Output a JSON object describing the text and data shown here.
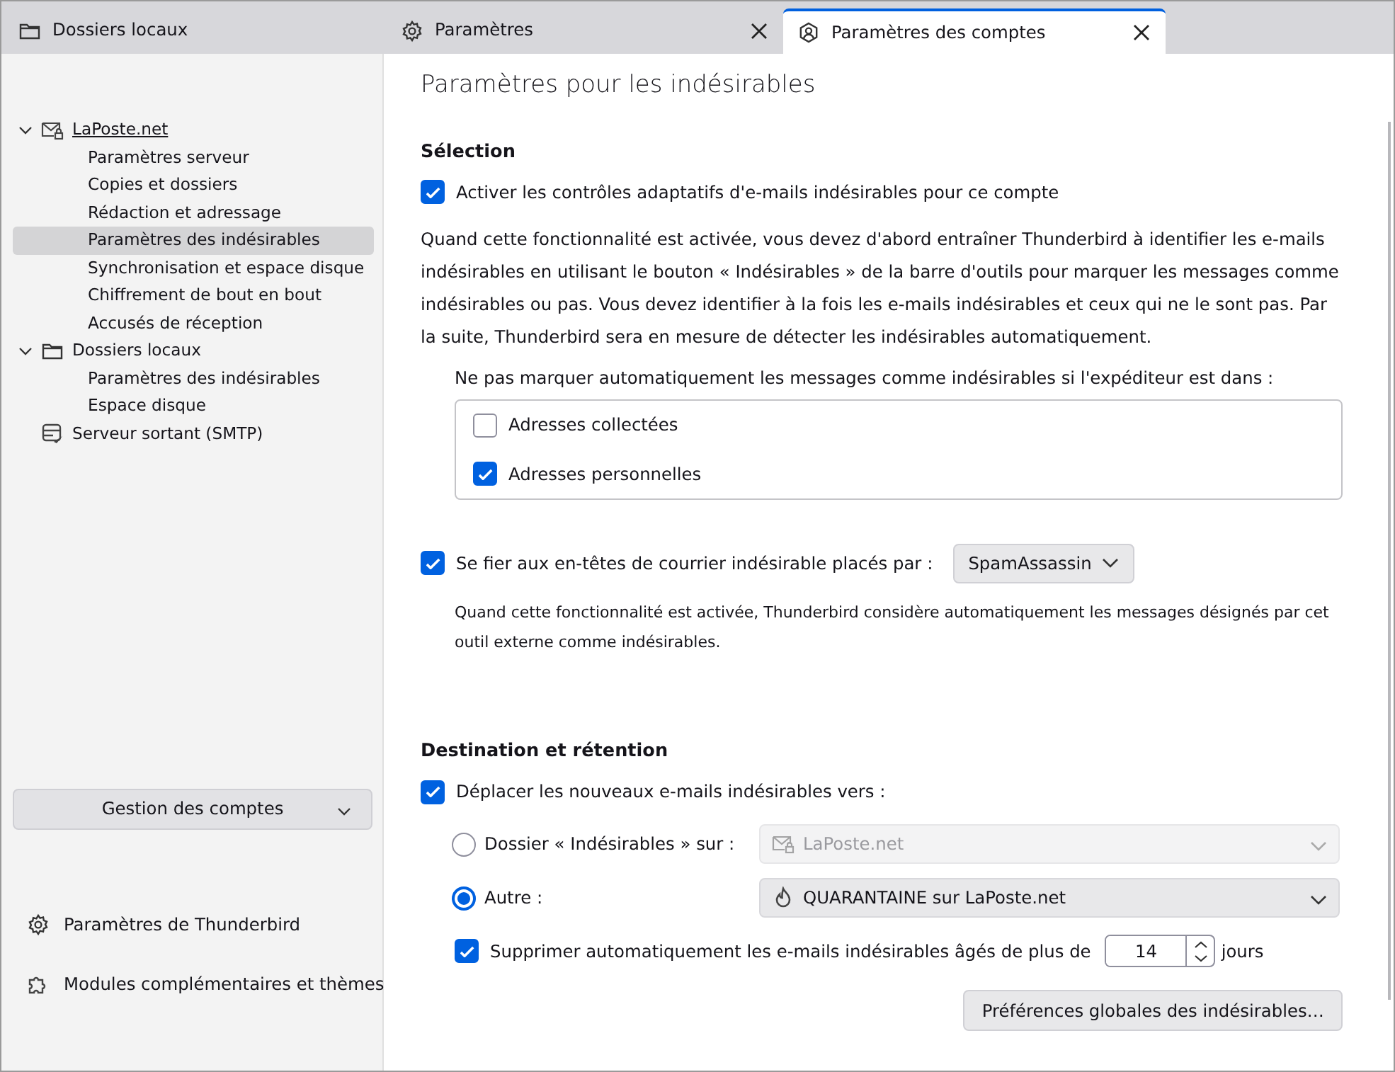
{
  "tabs": [
    {
      "label": "Dossiers locaux",
      "selected": false
    },
    {
      "label": "Paramètres",
      "selected": false
    },
    {
      "label": "Paramètres des comptes",
      "selected": true
    }
  ],
  "sidebar": {
    "tree": [
      {
        "label": "LaPoste.net",
        "expanded": true,
        "selected": false,
        "children": [
          {
            "label": "Paramètres serveur",
            "selected": false
          },
          {
            "label": "Copies et dossiers",
            "selected": false
          },
          {
            "label": "Rédaction et adressage",
            "selected": false
          },
          {
            "label": "Paramètres des indésirables",
            "selected": true
          },
          {
            "label": "Synchronisation et espace disque",
            "selected": false
          },
          {
            "label": "Chiffrement de bout en bout",
            "selected": false
          },
          {
            "label": "Accusés de réception",
            "selected": false
          }
        ]
      },
      {
        "label": "Dossiers locaux",
        "expanded": true,
        "selected": false,
        "children": [
          {
            "label": "Paramètres des indésirables",
            "selected": false
          },
          {
            "label": "Espace disque",
            "selected": false
          }
        ]
      },
      {
        "label": "Serveur sortant (SMTP)",
        "selected": false
      }
    ],
    "account_actions": "Gestion des comptes",
    "footer_links": [
      "Paramètres de Thunderbird",
      "Modules complémentaires et thèmes"
    ]
  },
  "page": {
    "title": "Paramètres pour les indésirables",
    "selection": {
      "heading": "Sélection",
      "adaptive": {
        "label": "Activer les contrôles adaptatifs d'e-mails indésirables pour ce compte",
        "checked": true
      },
      "description": "Quand cette fonctionnalité est activée, vous devez d'abord entraîner Thunderbird à identifier les e-mails indésirables en utilisant le bouton « Indésirables » de la barre d'outils pour marquer les messages comme indésirables ou pas. Vous devez identifier à la fois les e-mails indésirables et ceux qui ne le sont pas. Par la suite, Thunderbird sera en mesure de détecter les indésirables automatiquement.",
      "whitelist_label": "Ne pas marquer automatiquement les messages comme indésirables si l'expéditeur est dans :",
      "whitelist": [
        {
          "label": "Adresses collectées",
          "checked": false
        },
        {
          "label": "Adresses personnelles",
          "checked": true
        }
      ],
      "trust_headers": {
        "label": "Se fier aux en-têtes de courrier indésirable placés par :",
        "checked": true,
        "value": "SpamAssassin"
      },
      "trust_description": "Quand cette fonctionnalité est activée, Thunderbird considère automatiquement les messages désignés par cet outil externe comme indésirables."
    },
    "destination": {
      "heading": "Destination et rétention",
      "move": {
        "label": "Déplacer les nouveaux e-mails indésirables vers :",
        "checked": true
      },
      "targets": [
        {
          "label": "Dossier « Indésirables » sur :",
          "selected": false,
          "value": "LaPoste.net"
        },
        {
          "label": "Autre :",
          "selected": true,
          "value": "QUARANTAINE sur LaPoste.net"
        }
      ],
      "purge": {
        "label": "Supprimer automatiquement les e-mails indésirables âgés de plus de",
        "checked": true,
        "value": "14",
        "unit": "jours"
      },
      "global_button": "Préférences globales des indésirables…"
    }
  }
}
